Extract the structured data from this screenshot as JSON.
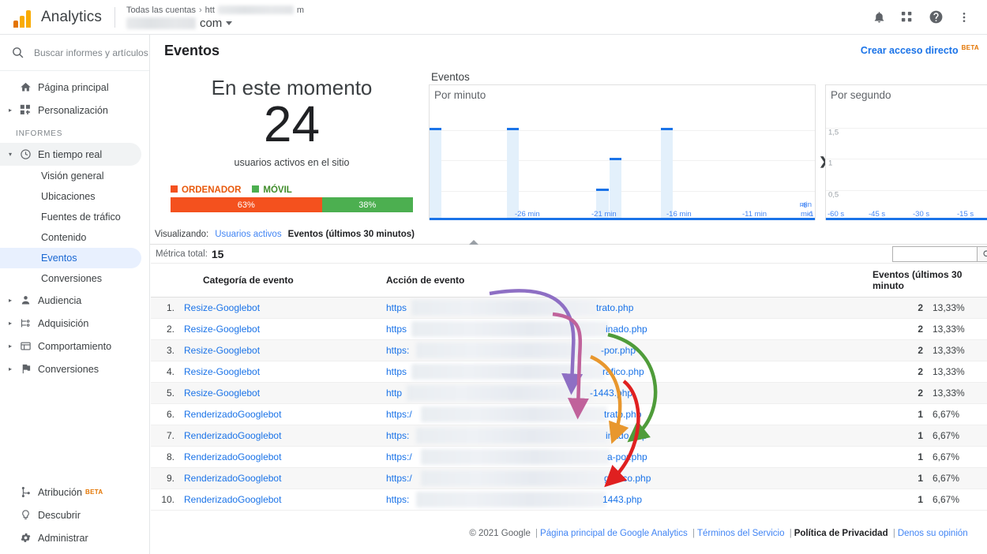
{
  "topbar": {
    "brand": "Analytics",
    "breadcrumb_all_accounts": "Todas las cuentas",
    "breadcrumb_sep": "›",
    "breadcrumb_property_prefix": "htt",
    "breadcrumb_property_suffix": "m",
    "account_name_suffix": "com",
    "icons": [
      "bell-icon",
      "apps-grid-icon",
      "help-icon",
      "more-vert-icon"
    ]
  },
  "sidebar": {
    "search_placeholder": "Buscar informes y artículos",
    "section_label": "INFORMES",
    "items": [
      {
        "label": "Página principal",
        "icon": "home-icon",
        "expandable": false
      },
      {
        "label": "Personalización",
        "icon": "customization-icon",
        "expandable": true
      }
    ],
    "reports": [
      {
        "label": "En tiempo real",
        "icon": "clock-icon",
        "expanded": true,
        "selected_group": true
      },
      {
        "label": "Audiencia",
        "icon": "person-icon",
        "expandable": true
      },
      {
        "label": "Adquisición",
        "icon": "acquisition-icon",
        "expandable": true
      },
      {
        "label": "Comportamiento",
        "icon": "behavior-icon",
        "expandable": true
      },
      {
        "label": "Conversiones",
        "icon": "flag-icon",
        "expandable": true
      }
    ],
    "realtime_children": [
      {
        "label": "Visión general",
        "selected": false
      },
      {
        "label": "Ubicaciones",
        "selected": false
      },
      {
        "label": "Fuentes de tráfico",
        "selected": false
      },
      {
        "label": "Contenido",
        "selected": false
      },
      {
        "label": "Eventos",
        "selected": true
      },
      {
        "label": "Conversiones",
        "selected": false
      }
    ],
    "bottom": [
      {
        "label": "Atribución",
        "icon": "attribution-icon",
        "badge": "BETA"
      },
      {
        "label": "Descubrir",
        "icon": "bulb-icon",
        "badge": ""
      },
      {
        "label": "Administrar",
        "icon": "gear-icon",
        "badge": ""
      }
    ]
  },
  "page": {
    "title": "Eventos",
    "shortcut_label": "Crear acceso directo",
    "shortcut_badge": "BETA"
  },
  "realtime": {
    "now_label": "En este momento",
    "active_users": "24",
    "active_users_sub": "usuarios activos en el sitio",
    "legend": [
      {
        "label": "ORDENADOR",
        "color": "#f4511e"
      },
      {
        "label": "MÓVIL",
        "color": "#4caf50"
      }
    ],
    "device_split": [
      {
        "label": "63%",
        "value": 63,
        "color": "#f4511e"
      },
      {
        "label": "38%",
        "value": 38,
        "color": "#4caf50"
      }
    ]
  },
  "chart_data": [
    {
      "type": "bar",
      "title": "Eventos",
      "subtitle": "Por minuto",
      "xlabel": "",
      "ylabel": "",
      "ylim": [
        0,
        3.6
      ],
      "yticks": [
        "1",
        "2",
        "3"
      ],
      "xticks": [
        "-26 min",
        "-21 min",
        "-16 min",
        "-11 min",
        "-6 min",
        "-1"
      ],
      "xtick_unit": "min",
      "x": [
        -30,
        -29,
        -28,
        -27,
        -26,
        -25,
        -24,
        -23,
        -22,
        -21,
        -20,
        -19,
        -18,
        -17,
        -16,
        -15,
        -14,
        -13,
        -12,
        -11,
        -10,
        -9,
        -8,
        -7,
        -6,
        -5,
        -4,
        -3,
        -2,
        -1
      ],
      "values": [
        3,
        0,
        0,
        0,
        0,
        0,
        3,
        0,
        0,
        0,
        0,
        0,
        0,
        1,
        2,
        0,
        0,
        0,
        3,
        0,
        0,
        0,
        0,
        0,
        0,
        0,
        0,
        0,
        0,
        0
      ],
      "grid": true,
      "bar_color": "#e3f0fb",
      "cap_color": "#1a73e8"
    },
    {
      "type": "bar",
      "title": "Eventos",
      "subtitle": "Por segundo",
      "xlabel": "",
      "ylabel": "",
      "ylim": [
        0,
        1.75
      ],
      "yticks": [
        "0,5",
        "1",
        "1,5"
      ],
      "xticks": [
        "-60 s",
        "-45 s",
        "-30 s",
        "-15 s"
      ],
      "x": [
        -60,
        -45,
        -30,
        -15
      ],
      "values": [
        0,
        0,
        0,
        0
      ],
      "grid": true,
      "bar_color": "#e3f0fb",
      "cap_color": "#1a73e8"
    }
  ],
  "viewing": {
    "label": "Visualizando:",
    "option_users": "Usuarios activos",
    "option_events": "Eventos (últimos 30 minutos)"
  },
  "table": {
    "metric_total_label": "Métrica total:",
    "metric_total_value": "15",
    "search_value": "",
    "search_icon": "search-icon",
    "columns": {
      "index": "",
      "category": "Categoría de evento",
      "action": "Acción de evento",
      "events": "Eventos (últimos 30 minuto"
    },
    "rows": [
      {
        "index": "1.",
        "category": "Resize-Googlebot",
        "url_prefix": "https",
        "url_suffix": "trato.php",
        "events": "2",
        "pct": "13,33%"
      },
      {
        "index": "2.",
        "category": "Resize-Googlebot",
        "url_prefix": "https",
        "url_suffix": "inado.php",
        "events": "2",
        "pct": "13,33%"
      },
      {
        "index": "3.",
        "category": "Resize-Googlebot",
        "url_prefix": "https:",
        "url_suffix": "-por.php",
        "events": "2",
        "pct": "13,33%"
      },
      {
        "index": "4.",
        "category": "Resize-Googlebot",
        "url_prefix": "https",
        "url_suffix": "rafico.php",
        "events": "2",
        "pct": "13,33%"
      },
      {
        "index": "5.",
        "category": "Resize-Googlebot",
        "url_prefix": "http",
        "url_suffix": "-1443.php",
        "events": "2",
        "pct": "13,33%"
      },
      {
        "index": "6.",
        "category": "RenderizadoGooglebot",
        "url_prefix": "https:/",
        "url_suffix": "trato.php",
        "events": "1",
        "pct": "6,67%"
      },
      {
        "index": "7.",
        "category": "RenderizadoGooglebot",
        "url_prefix": "https:",
        "url_suffix": "inado.php",
        "events": "1",
        "pct": "6,67%"
      },
      {
        "index": "8.",
        "category": "RenderizadoGooglebot",
        "url_prefix": "https:/",
        "url_suffix": "a-por.php",
        "events": "1",
        "pct": "6,67%"
      },
      {
        "index": "9.",
        "category": "RenderizadoGooglebot",
        "url_prefix": "https:/",
        "url_suffix": "grafico.php",
        "events": "1",
        "pct": "6,67%"
      },
      {
        "index": "10.",
        "category": "RenderizadoGooglebot",
        "url_prefix": "https:",
        "url_suffix": "1443.php",
        "events": "1",
        "pct": "6,67%"
      }
    ]
  },
  "annotations": {
    "arrows": [
      {
        "name": "arrow-row1-to-row6",
        "color": "#8e6fc4",
        "from_row": 1,
        "to_row": 6
      },
      {
        "name": "arrow-row2-to-row7",
        "color": "#c0629b",
        "from_row": 2,
        "to_row": 7
      },
      {
        "name": "arrow-row3-to-row9",
        "color": "#4f9c3a",
        "from_row": 3,
        "to_row": 9
      },
      {
        "name": "arrow-row4-to-row8",
        "color": "#e8972e",
        "from_row": 4,
        "to_row": 8
      },
      {
        "name": "arrow-row5-to-row10",
        "color": "#e02020",
        "from_row": 5,
        "to_row": 10
      }
    ]
  },
  "footer": {
    "copyright": "© 2021 Google",
    "links": [
      {
        "label": "Página principal de Google Analytics",
        "strong": false
      },
      {
        "label": "Términos del Servicio",
        "strong": false
      },
      {
        "label": "Política de Privacidad",
        "strong": true
      },
      {
        "label": "Denos su opinión",
        "strong": false
      }
    ]
  }
}
